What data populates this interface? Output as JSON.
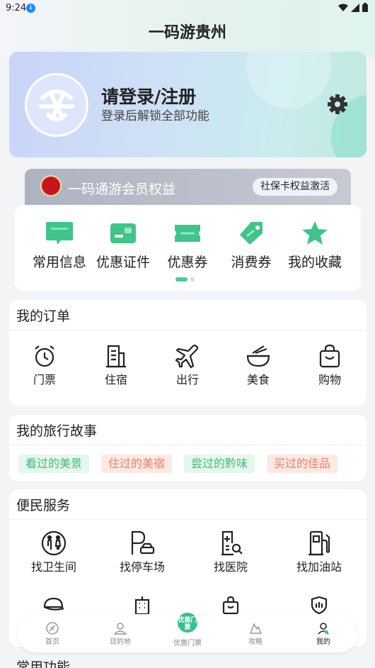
{
  "status": {
    "time": "9:24"
  },
  "header": {
    "title": "一码游贵州"
  },
  "profile": {
    "login_title": "请登录/注册",
    "login_sub": "登录后解锁全部功能"
  },
  "member": {
    "text": "一码通游会员权益",
    "badge": "社保卡权益激活"
  },
  "quick": {
    "items": [
      {
        "label": "常用信息",
        "icon": "message-icon"
      },
      {
        "label": "优惠证件",
        "icon": "id-card-icon"
      },
      {
        "label": "优惠券",
        "icon": "coupon-icon"
      },
      {
        "label": "消费券",
        "icon": "tag-icon"
      },
      {
        "label": "我的收藏",
        "icon": "star-icon"
      }
    ]
  },
  "orders": {
    "title": "我的订单",
    "items": [
      {
        "label": "门票",
        "icon": "alarm-clock-icon"
      },
      {
        "label": "住宿",
        "icon": "building-icon"
      },
      {
        "label": "出行",
        "icon": "airplane-icon"
      },
      {
        "label": "美食",
        "icon": "bowl-icon"
      },
      {
        "label": "购物",
        "icon": "shopping-bag-icon"
      }
    ]
  },
  "stories": {
    "title": "我的旅行故事",
    "tags": [
      "看过的美景",
      "住过的美宿",
      "尝过的黔味",
      "买过的佳品"
    ]
  },
  "services": {
    "title": "便民服务",
    "items": [
      {
        "label": "找卫生间",
        "icon": "toilet-icon"
      },
      {
        "label": "找停车场",
        "icon": "parking-icon"
      },
      {
        "label": "找医院",
        "icon": "hospital-icon"
      },
      {
        "label": "找加油站",
        "icon": "gas-station-icon"
      }
    ]
  },
  "tabbar": {
    "items": [
      {
        "label": "首页",
        "icon": "home-icon"
      },
      {
        "label": "目的地",
        "icon": "location-icon"
      },
      {
        "label": "优惠门票",
        "icon": "ticket-icon",
        "badge": "优惠门票"
      },
      {
        "label": "攻略",
        "icon": "guide-icon"
      },
      {
        "label": "我的",
        "icon": "profile-icon"
      }
    ]
  },
  "common": {
    "title": "常用功能"
  },
  "colors": {
    "accent": "#4ecb95",
    "green_tag": "#3fbd7a",
    "orange_tag": "#f0805f"
  }
}
